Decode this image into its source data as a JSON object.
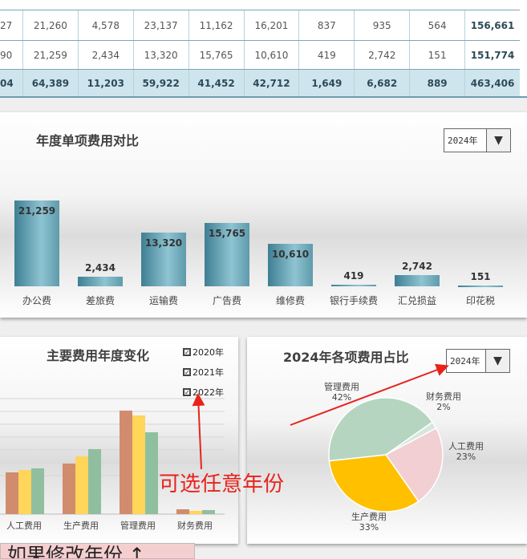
{
  "table": {
    "rows": [
      [
        "27",
        "21,260",
        "4,578",
        "23,137",
        "11,162",
        "16,201",
        "837",
        "935",
        "564",
        "156,661"
      ],
      [
        "90",
        "21,259",
        "2,434",
        "13,320",
        "15,765",
        "10,610",
        "419",
        "2,742",
        "151",
        "151,774"
      ]
    ],
    "total": [
      "04",
      "64,389",
      "11,203",
      "59,922",
      "41,452",
      "42,712",
      "1,649",
      "6,682",
      "889",
      "463,406"
    ]
  },
  "bar_panel": {
    "title": "年度单项费用对比",
    "year_select": "2024年"
  },
  "line_panel": {
    "title": "主要费用年度变化",
    "legend": [
      "2020年",
      "2021年",
      "2022年"
    ]
  },
  "pie_panel": {
    "title": "2024年各项费用占比",
    "year_select": "2024年"
  },
  "annotation": {
    "text": "可选任意年份",
    "note": "如果修改年份 ↑"
  },
  "colors": {
    "y2020": "#d08c6c",
    "y2021": "#ffd55a",
    "y2022": "#8fbf9f"
  },
  "chart_data": [
    {
      "type": "bar",
      "title": "年度单项费用对比",
      "categories": [
        "办公费",
        "差旅费",
        "运输费",
        "广告费",
        "维修费",
        "银行手续费",
        "汇兑损益",
        "印花税"
      ],
      "values": [
        21259,
        2434,
        13320,
        15765,
        10610,
        419,
        2742,
        151
      ],
      "labels": [
        "21,259",
        "2,434",
        "13,320",
        "15,765",
        "10,610",
        "419",
        "2,742",
        "151"
      ]
    },
    {
      "type": "bar",
      "title": "主要费用年度变化",
      "categories": [
        "人工费用",
        "生产费用",
        "管理费用",
        "财务费用"
      ],
      "series": [
        {
          "name": "2020年",
          "values": [
            52,
            63,
            129,
            6
          ]
        },
        {
          "name": "2021年",
          "values": [
            55,
            72,
            123,
            4
          ]
        },
        {
          "name": "2022年",
          "values": [
            57,
            81,
            102,
            5
          ]
        }
      ]
    },
    {
      "type": "pie",
      "title": "2024年各项费用占比",
      "slices": [
        {
          "name": "财务费用",
          "pct": 2,
          "label": "2%",
          "color": "#d5e8df"
        },
        {
          "name": "人工费用",
          "pct": 23,
          "label": "23%",
          "color": "#f2cfd3"
        },
        {
          "name": "生产费用",
          "pct": 33,
          "label": "33%",
          "color": "#ffc000"
        },
        {
          "name": "管理费用",
          "pct": 42,
          "label": "42%",
          "color": "#b5d5c1"
        }
      ]
    }
  ]
}
